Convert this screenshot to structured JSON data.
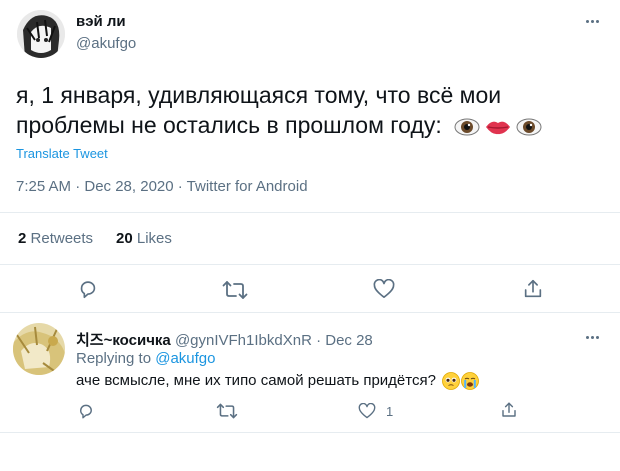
{
  "tweet": {
    "author": {
      "display_name": "вэй ли",
      "handle": "@akufgo"
    },
    "text": "я, 1 января, удивляющаяся тому, что всё мои проблемы не остались в прошлом году:",
    "emoji": [
      "eye-emoji",
      "lips-emoji",
      "eye-emoji"
    ],
    "translate_label": "Translate Tweet",
    "meta": "7:25 AM · Dec 28, 2020 · Twitter for Android",
    "stats": {
      "retweets_count": "2",
      "retweets_label": "Retweets",
      "likes_count": "20",
      "likes_label": "Likes"
    },
    "actions": [
      "reply-icon",
      "retweet-icon",
      "like-icon",
      "share-icon"
    ]
  },
  "reply": {
    "author": {
      "display_name": "치즈~косичка",
      "handle": "@gynIVFh1IbkdXnR",
      "date": "Dec 28"
    },
    "replying_prefix": "Replying to",
    "replying_to": "@akufgo",
    "text": "аче всмысле, мне их типо самой решать придётся?",
    "emoji": [
      "pleading-face-emoji",
      "crying-face-emoji"
    ],
    "like_count": "1",
    "actions": [
      "reply-icon",
      "retweet-icon",
      "like-icon",
      "share-icon"
    ]
  },
  "colors": {
    "link": "#1b95e0",
    "muted": "#5b7083",
    "border": "#e6ecf0",
    "text": "#0f1419"
  }
}
